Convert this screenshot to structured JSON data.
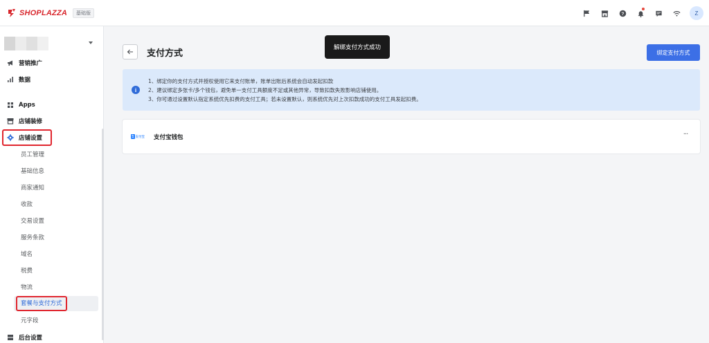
{
  "brand": {
    "name": "SHOPLAZZA",
    "edition": "基础版",
    "color": "#d8262c"
  },
  "topbar": {
    "icons": [
      "flag-icon",
      "store-icon",
      "help-icon",
      "bell-icon",
      "message-icon",
      "wifi-icon"
    ],
    "avatar_letter": "Z"
  },
  "sidebar": {
    "top_items": [
      {
        "label": "营销推广",
        "icon": "megaphone-icon"
      },
      {
        "label": "数据",
        "icon": "bar-chart-icon"
      },
      {
        "label": "Apps",
        "icon": "apps-icon"
      },
      {
        "label": "店铺装修",
        "icon": "storefront-icon"
      },
      {
        "label": "店铺设置",
        "icon": "gear-icon"
      }
    ],
    "sub_items": [
      "员工管理",
      "基础信息",
      "商家通知",
      "收款",
      "交易设置",
      "服务条款",
      "域名",
      "税费",
      "物流",
      "套餐与支付方式",
      "元字段"
    ],
    "bottom_item": {
      "label": "后台设置",
      "icon": "server-icon"
    }
  },
  "main": {
    "title": "支付方式",
    "bind_button": "绑定支付方式",
    "toast": "解绑支付方式成功",
    "info_lines": [
      "1、绑定你的支付方式并授权使用它来支付账单，账单出账后系统会自动发起扣款",
      "2、建议绑定多张卡/多个钱包，避免单一支付工具额度不足或其他异常，导致扣款失败影响店铺使用。",
      "3、你可通过设置默认指定系统优先扣费的支付工具；若未设置默认，则系统优先对上次扣款成功的支付工具发起扣费。"
    ],
    "payment_methods": [
      {
        "name": "支付宝钱包",
        "logo_text": "支付宝"
      }
    ],
    "more_label": "···"
  },
  "colors": {
    "primary": "#3c6fe6",
    "info_bg": "#dbe9fb",
    "highlight": "#e0252e"
  }
}
